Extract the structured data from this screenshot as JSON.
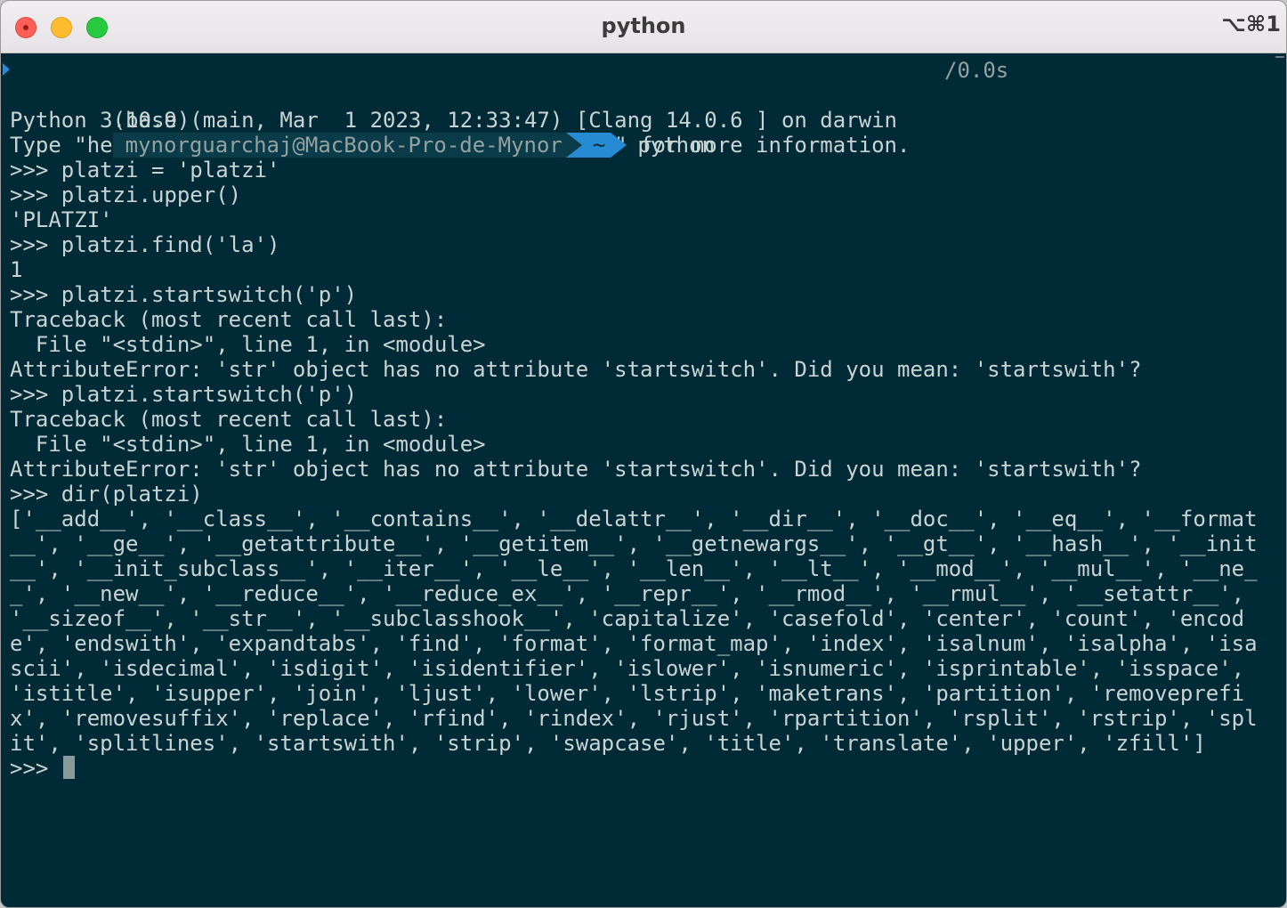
{
  "window": {
    "title": "python",
    "shortcut": "⌥⌘1"
  },
  "terminal": {
    "timing": "/0.0s",
    "prompt": {
      "env": "(base)",
      "user_host": "mynorguarchaj@MacBook-Pro-de-Mynor",
      "dir": "~",
      "command": "python"
    },
    "lines": [
      "Python 3.10.9 (main, Mar  1 2023, 12:33:47) [Clang 14.0.6 ] on darwin",
      "Type \"help\", \"copyright\", \"credits\" or \"license\" for more information.",
      ">>> platzi = 'platzi'",
      ">>> platzi.upper()",
      "'PLATZI'",
      ">>> platzi.find('la')",
      "1",
      ">>> platzi.startswitch('p')",
      "Traceback (most recent call last):",
      "  File \"<stdin>\", line 1, in <module>",
      "AttributeError: 'str' object has no attribute 'startswitch'. Did you mean: 'startswith'?",
      ">>> platzi.startswitch('p')",
      "Traceback (most recent call last):",
      "  File \"<stdin>\", line 1, in <module>",
      "AttributeError: 'str' object has no attribute 'startswitch'. Did you mean: 'startswith'?",
      ">>> dir(platzi)"
    ],
    "dir_output": "['__add__', '__class__', '__contains__', '__delattr__', '__dir__', '__doc__', '__eq__', '__format__', '__ge__', '__getattribute__', '__getitem__', '__getnewargs__', '__gt__', '__hash__', '__init__', '__init_subclass__', '__iter__', '__le__', '__len__', '__lt__', '__mod__', '__mul__', '__ne__', '__new__', '__reduce__', '__reduce_ex__', '__repr__', '__rmod__', '__rmul__', '__setattr__', '__sizeof__', '__str__', '__subclasshook__', 'capitalize', 'casefold', 'center', 'count', 'encode', 'endswith', 'expandtabs', 'find', 'format', 'format_map', 'index', 'isalnum', 'isalpha', 'isascii', 'isdecimal', 'isdigit', 'isidentifier', 'islower', 'isnumeric', 'isprintable', 'isspace', 'istitle', 'isupper', 'join', 'ljust', 'lower', 'lstrip', 'maketrans', 'partition', 'removeprefix', 'removesuffix', 'replace', 'rfind', 'rindex', 'rjust', 'rpartition', 'rsplit', 'rstrip', 'split', 'splitlines', 'startswith', 'strip', 'swapcase', 'title', 'translate', 'upper', 'zfill']",
    "final_prompt": ">>> "
  },
  "colors": {
    "background": "#002b36",
    "foreground": "#c9d3d3",
    "accent": "#268bd2"
  }
}
